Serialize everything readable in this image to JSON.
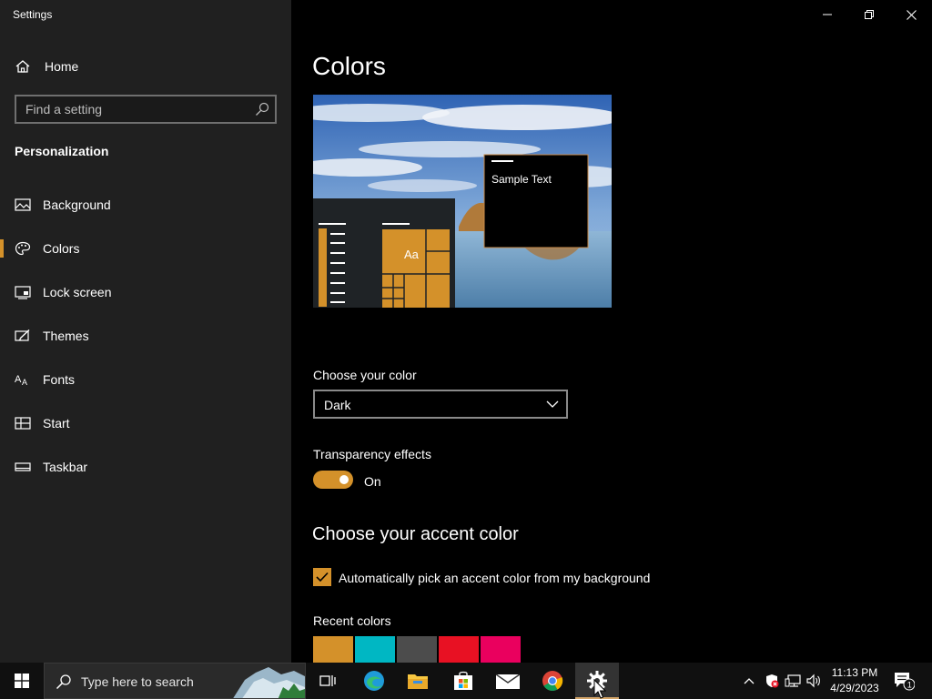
{
  "window": {
    "title": "Settings"
  },
  "sidebar": {
    "home_label": "Home",
    "search_placeholder": "Find a setting",
    "section_title": "Personalization",
    "items": [
      {
        "label": "Background",
        "icon": "picture-icon"
      },
      {
        "label": "Colors",
        "icon": "palette-icon",
        "selected": true
      },
      {
        "label": "Lock screen",
        "icon": "lock-screen-icon"
      },
      {
        "label": "Themes",
        "icon": "brush-icon"
      },
      {
        "label": "Fonts",
        "icon": "font-icon"
      },
      {
        "label": "Start",
        "icon": "start-layout-icon"
      },
      {
        "label": "Taskbar",
        "icon": "taskbar-icon"
      }
    ]
  },
  "main": {
    "title": "Colors",
    "preview": {
      "sample_text": "Sample Text",
      "tile_text": "Aa"
    },
    "choose_color": {
      "label": "Choose your color",
      "selected": "Dark"
    },
    "transparency": {
      "label": "Transparency effects",
      "state": "On",
      "enabled": true
    },
    "accent": {
      "title": "Choose your accent color",
      "auto_pick_label": "Automatically pick an accent color from my background",
      "auto_pick_checked": true
    },
    "recent_colors": {
      "label": "Recent colors",
      "swatches": [
        "#d4912a",
        "#00b7c3",
        "#4c4c4c",
        "#e81123",
        "#ea005e"
      ]
    }
  },
  "taskbar": {
    "search_placeholder": "Type here to search",
    "apps": [
      "task-view-icon",
      "edge-icon",
      "file-explorer-icon",
      "store-icon",
      "mail-icon",
      "chrome-icon",
      "settings-icon"
    ],
    "clock_time": "11:13 PM",
    "clock_date": "4/29/2023",
    "notification_count": "1"
  },
  "colors": {
    "accent": "#d4912a",
    "sidebar_bg": "#202020",
    "content_bg": "#000000"
  }
}
